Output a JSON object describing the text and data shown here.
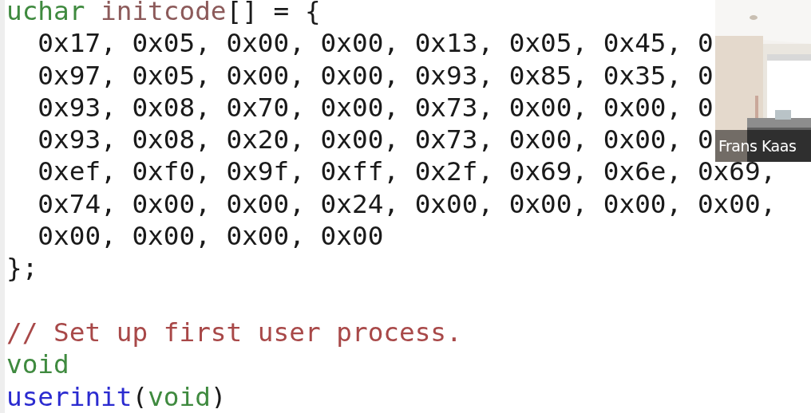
{
  "code_blocks": [
    {
      "lines": [
        {
          "segments": [
            {
              "kind": "type",
              "text": "uchar "
            },
            {
              "kind": "ident",
              "text": "initcode"
            },
            {
              "kind": "plain",
              "text": "[] = {"
            }
          ]
        },
        {
          "segments": [
            {
              "kind": "plain",
              "text": "  0x17, 0x05, 0x00, 0x00, 0x13, 0x05, 0x45, 0"
            }
          ]
        },
        {
          "segments": [
            {
              "kind": "plain",
              "text": "  0x97, 0x05, 0x00, 0x00, 0x93, 0x85, 0x35, 0"
            }
          ]
        },
        {
          "segments": [
            {
              "kind": "plain",
              "text": "  0x93, 0x08, 0x70, 0x00, 0x73, 0x00, 0x00, 0"
            }
          ]
        },
        {
          "segments": [
            {
              "kind": "plain",
              "text": "  0x93, 0x08, 0x20, 0x00, 0x73, 0x00, 0x00, 0"
            }
          ]
        },
        {
          "segments": [
            {
              "kind": "plain",
              "text": "  0xef, 0xf0, 0x9f, 0xff, 0x2f, 0x69, 0x6e, 0x69,"
            }
          ]
        },
        {
          "segments": [
            {
              "kind": "plain",
              "text": "  0x74, 0x00, 0x00, 0x24, 0x00, 0x00, 0x00, 0x00,"
            }
          ]
        },
        {
          "segments": [
            {
              "kind": "plain",
              "text": "  0x00, 0x00, 0x00, 0x00"
            }
          ]
        },
        {
          "segments": [
            {
              "kind": "plain",
              "text": "};"
            }
          ]
        }
      ]
    },
    {
      "lines": [
        {
          "segments": [
            {
              "kind": "comment",
              "text": "// Set up first user process."
            }
          ]
        },
        {
          "segments": [
            {
              "kind": "type",
              "text": "void"
            }
          ]
        },
        {
          "segments": [
            {
              "kind": "function",
              "text": "userinit"
            },
            {
              "kind": "plain",
              "text": "("
            },
            {
              "kind": "type",
              "text": "void"
            },
            {
              "kind": "plain",
              "text": ")"
            }
          ]
        }
      ]
    }
  ],
  "video": {
    "kind": "picture",
    "participant_name": "Frans Kaas"
  }
}
